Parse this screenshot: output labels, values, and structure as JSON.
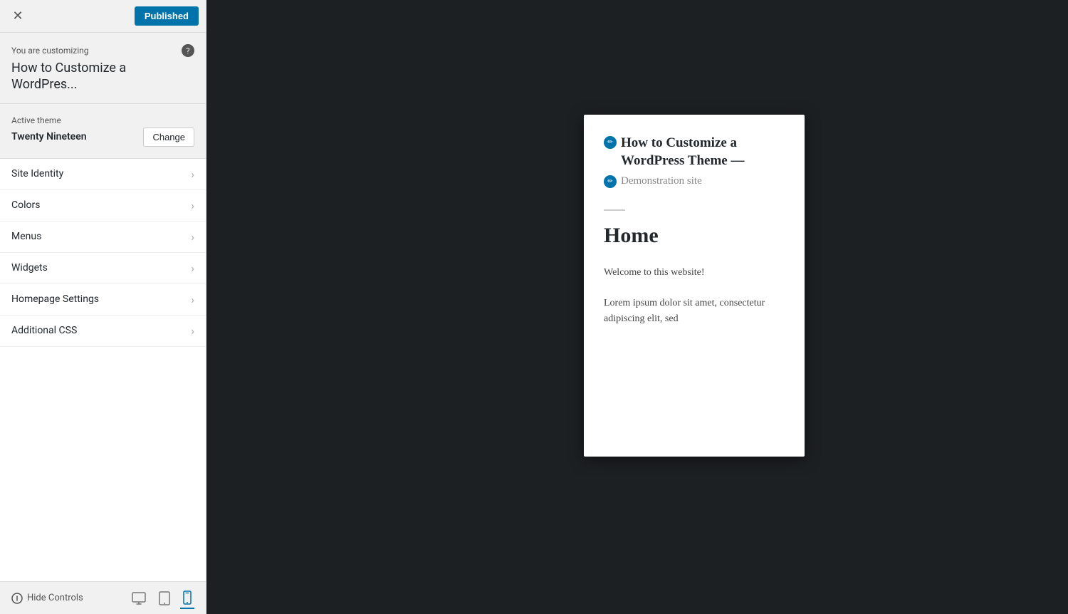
{
  "topbar": {
    "close_label": "✕",
    "published_label": "Published"
  },
  "customizing": {
    "label": "You are customizing",
    "title": "How to Customize a WordPres...",
    "help_icon": "?"
  },
  "active_theme": {
    "label": "Active theme",
    "name": "Twenty Nineteen",
    "change_label": "Change"
  },
  "menu_items": [
    {
      "label": "Site Identity"
    },
    {
      "label": "Colors"
    },
    {
      "label": "Menus"
    },
    {
      "label": "Widgets"
    },
    {
      "label": "Homepage Settings"
    },
    {
      "label": "Additional CSS"
    }
  ],
  "bottom_bar": {
    "hide_controls_label": "Hide Controls",
    "view_desktop_icon": "desktop",
    "view_tablet_icon": "tablet",
    "view_mobile_icon": "mobile"
  },
  "preview": {
    "site_title": "How to Customize a WordPress Theme —",
    "tagline": "Demonstration site",
    "page_title": "Home",
    "welcome_text": "Welcome to this website!",
    "lorem_text": "Lorem ipsum dolor sit amet, consectetur adipiscing elit, sed"
  }
}
